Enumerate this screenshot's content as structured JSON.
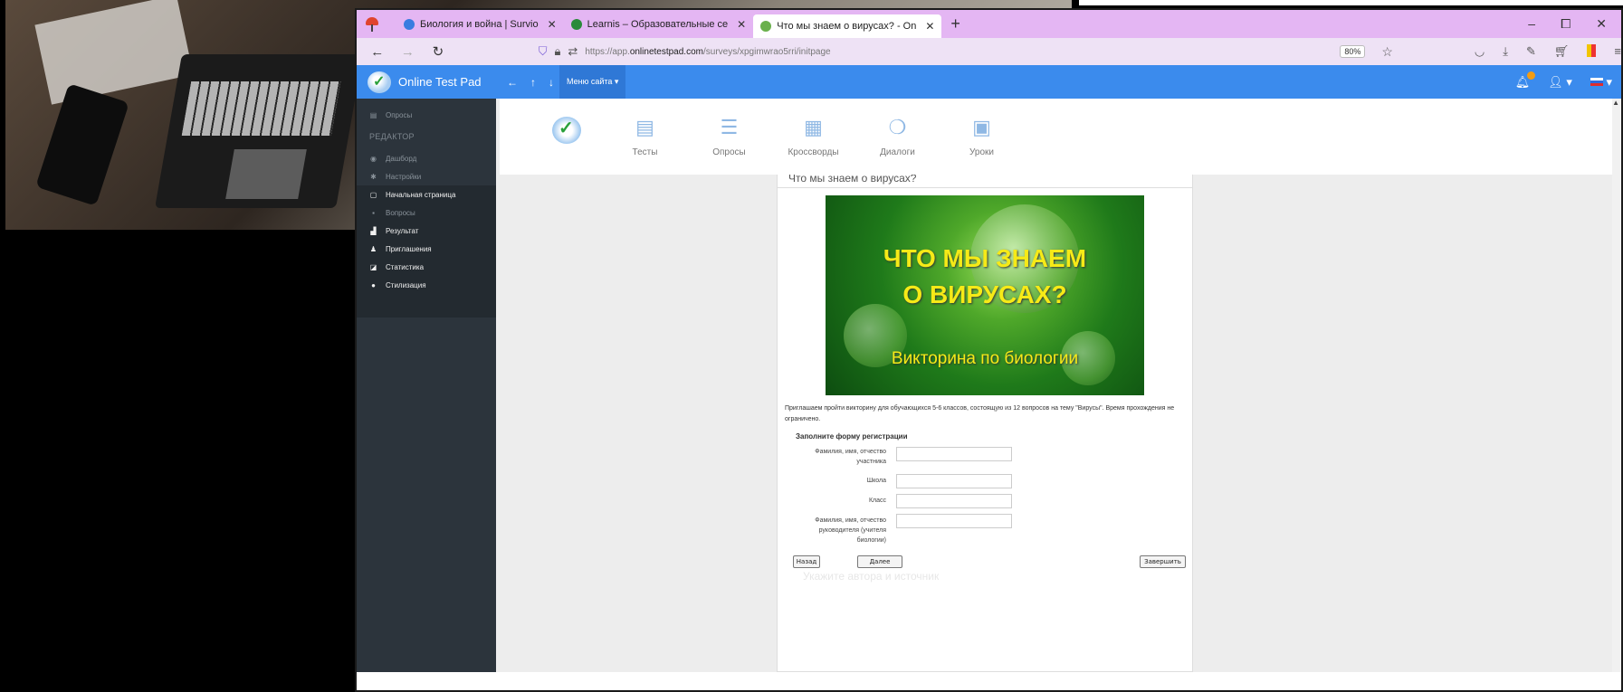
{
  "browser": {
    "tabs": [
      {
        "label": "Биология и война | Survio",
        "icon_color": "#3a7ce0"
      },
      {
        "label": "Learnis – Образовательные се",
        "icon_color": "#2a8a3a"
      },
      {
        "label": "Что мы знаем о вирусах? - On",
        "icon_color": "#6ab04c",
        "active": true
      }
    ],
    "new_tab": "+",
    "window_controls": [
      "–",
      "⧠",
      "✕"
    ],
    "url_prefix": "https://app.",
    "url_domain": "onlinetestpad.com",
    "url_path": "/surveys/xpgimwrao5rri/initpage",
    "zoom": "80%"
  },
  "app": {
    "brand": "Online Test Pad",
    "nav_back": "←",
    "nav_up": "↑",
    "nav_down": "↓",
    "menu_site": "Меню сайта ▾"
  },
  "sidebar": {
    "top_item": "Опросы",
    "section": "РЕДАКТОР",
    "editor_items": [
      "Дашборд",
      "Настройки"
    ],
    "page_items": [
      "Начальная страница",
      "Вопросы",
      "Результат",
      "Приглашения",
      "Статистика",
      "Стилизация"
    ]
  },
  "toolbox": {
    "items": [
      "Тесты",
      "Опросы",
      "Кроссворды",
      "Диалоги",
      "Уроки"
    ]
  },
  "survey": {
    "title": "Что мы знаем о вирусах?",
    "banner_title_line1": "ЧТО МЫ ЗНАЕМ",
    "banner_title_line2": "О ВИРУСАХ?",
    "banner_subtitle": "Викторина по биологии",
    "intro": "Приглашаем пройти викторину для обучающихся 5-6 классов, состоящую из 12 вопросов на тему \"Вирусы\". Время прохождения не ограничено.",
    "form_title": "Заполните форму регистрации",
    "fields": [
      "Фамилия, имя, отчество участника",
      "Школа",
      "Класс",
      "Фамилия, имя, отчество руководителя (учителя биологии)"
    ],
    "btn_back": "Назад",
    "btn_next": "Далее",
    "btn_finish": "Завершить",
    "watermark": "Укажите автора и источник"
  },
  "colors": {
    "tabbar": "#e4b6f3",
    "header": "#3b8bed",
    "sidebar": "#2c343c",
    "banner_text": "#f6ea17"
  }
}
